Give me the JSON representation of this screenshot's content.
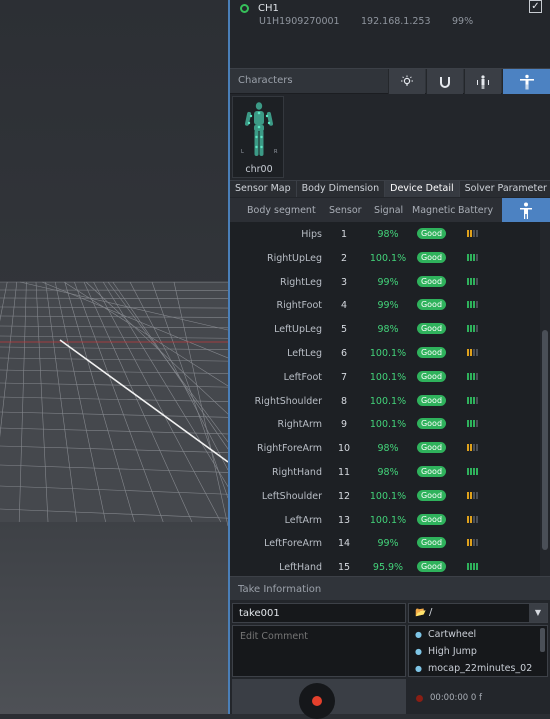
{
  "device": {
    "channel": "CH1",
    "serial": "U1H1909270001",
    "ip": "192.168.1.253",
    "battery": "99%",
    "checked": true,
    "status_color": "#36c05a"
  },
  "characters": {
    "title": "Characters",
    "toolbar_icons": [
      "bulb-icon",
      "magnet-icon",
      "body-split-icon",
      "t-pose-icon"
    ],
    "items": [
      {
        "name": "chr00",
        "left_label": "L",
        "right_label": "R"
      }
    ]
  },
  "tabs": [
    {
      "label": "Sensor Map",
      "active": false
    },
    {
      "label": "Body Dimension",
      "active": false
    },
    {
      "label": "Device Detail",
      "active": true
    },
    {
      "label": "Solver Parameter",
      "active": false
    }
  ],
  "table": {
    "headers": {
      "segment": "Body segment",
      "sensor": "Sensor",
      "signal": "Signal",
      "magnetic": "Magnetic",
      "battery": "Battery"
    },
    "rows": [
      {
        "segment": "Hips",
        "sensor": "1",
        "signal": "98%",
        "magnetic": "Good",
        "battery_level": 0.5
      },
      {
        "segment": "RightUpLeg",
        "sensor": "2",
        "signal": "100.1%",
        "magnetic": "Good",
        "battery_level": 0.75
      },
      {
        "segment": "RightLeg",
        "sensor": "3",
        "signal": "99%",
        "magnetic": "Good",
        "battery_level": 0.75
      },
      {
        "segment": "RightFoot",
        "sensor": "4",
        "signal": "99%",
        "magnetic": "Good",
        "battery_level": 0.75
      },
      {
        "segment": "LeftUpLeg",
        "sensor": "5",
        "signal": "98%",
        "magnetic": "Good",
        "battery_level": 0.75
      },
      {
        "segment": "LeftLeg",
        "sensor": "6",
        "signal": "100.1%",
        "magnetic": "Good",
        "battery_level": 0.5
      },
      {
        "segment": "LeftFoot",
        "sensor": "7",
        "signal": "100.1%",
        "magnetic": "Good",
        "battery_level": 0.75
      },
      {
        "segment": "RightShoulder",
        "sensor": "8",
        "signal": "100.1%",
        "magnetic": "Good",
        "battery_level": 0.75
      },
      {
        "segment": "RightArm",
        "sensor": "9",
        "signal": "100.1%",
        "magnetic": "Good",
        "battery_level": 0.75
      },
      {
        "segment": "RightForeArm",
        "sensor": "10",
        "signal": "98%",
        "magnetic": "Good",
        "battery_level": 0.5
      },
      {
        "segment": "RightHand",
        "sensor": "11",
        "signal": "98%",
        "magnetic": "Good",
        "battery_level": 1.0
      },
      {
        "segment": "LeftShoulder",
        "sensor": "12",
        "signal": "100.1%",
        "magnetic": "Good",
        "battery_level": 0.5
      },
      {
        "segment": "LeftArm",
        "sensor": "13",
        "signal": "100.1%",
        "magnetic": "Good",
        "battery_level": 0.5
      },
      {
        "segment": "LeftForeArm",
        "sensor": "14",
        "signal": "99%",
        "magnetic": "Good",
        "battery_level": 0.5
      },
      {
        "segment": "LeftHand",
        "sensor": "15",
        "signal": "95.9%",
        "magnetic": "Good",
        "battery_level": 1.0
      }
    ]
  },
  "side_buttons": [
    "body-icon",
    "expand-icon"
  ],
  "take": {
    "title": "Take Information",
    "name": "take001",
    "path": "/",
    "comment_placeholder": "Edit Comment",
    "list": [
      "Cartwheel",
      "High Jump",
      "mocap_22minutes_02"
    ],
    "timer": "00:00:00 0 f"
  },
  "colors": {
    "accent": "#4c82c2",
    "good": "#2fb25c",
    "signal": "#43d37a",
    "battery_low": "#e0a21c",
    "record": "#e4402c"
  }
}
